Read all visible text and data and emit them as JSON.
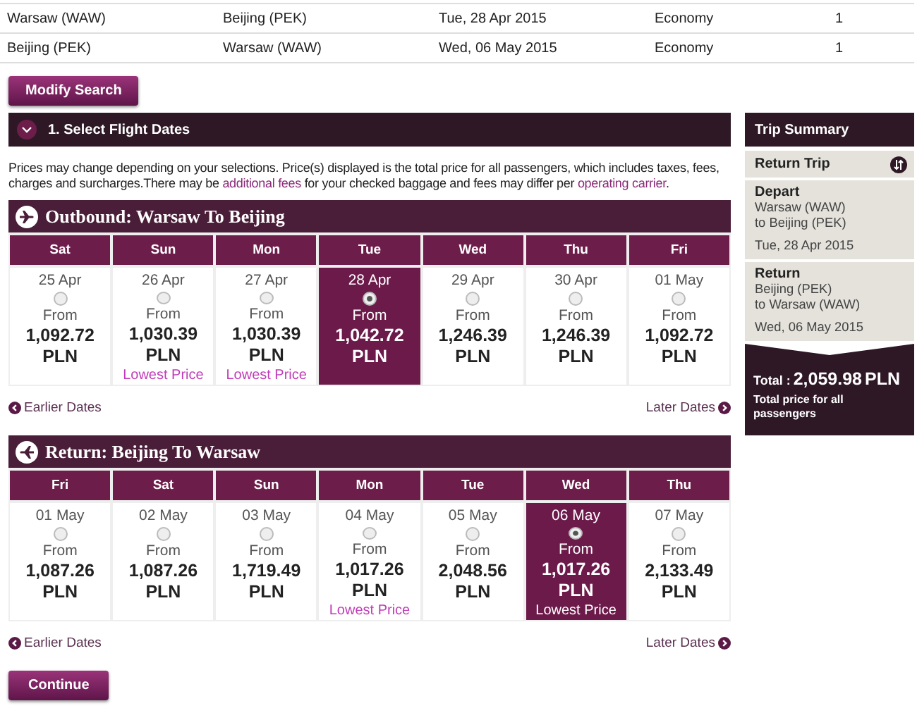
{
  "search_rows": [
    {
      "from": "Warsaw (WAW)",
      "to": "Beijing (PEK)",
      "date": "Tue, 28 Apr 2015",
      "cabin": "Economy",
      "passengers": "1"
    },
    {
      "from": "Beijing (PEK)",
      "to": "Warsaw (WAW)",
      "date": "Wed, 06 May 2015",
      "cabin": "Economy",
      "passengers": "1"
    }
  ],
  "modify_button": "Modify Search",
  "section": {
    "title": "1. Select Flight Dates",
    "expanded": true
  },
  "notice": [
    {
      "kind": "text",
      "text": "Prices may change depending on your selections. Price(s) displayed is the total price for all passengers, which includes taxes, fees, charges and surcharges.There may be "
    },
    {
      "kind": "link",
      "text": "additional fees"
    },
    {
      "kind": "text",
      "text": " for your checked baggage and fees may differ per "
    },
    {
      "kind": "link",
      "text": "operating carrier"
    },
    {
      "kind": "text",
      "text": "."
    }
  ],
  "flights": [
    {
      "kind": "outbound",
      "title": "Outbound: Warsaw To Beijing",
      "earlier": "Earlier Dates",
      "later": "Later Dates",
      "days": [
        {
          "weekday": "Sat",
          "date": "25 Apr",
          "from": "From",
          "price": "1,092.72",
          "currency": "PLN",
          "selected": false
        },
        {
          "weekday": "Sun",
          "date": "26 Apr",
          "from": "From",
          "price": "1,030.39",
          "currency": "PLN",
          "note": "Lowest Price",
          "selected": false
        },
        {
          "weekday": "Mon",
          "date": "27 Apr",
          "from": "From",
          "price": "1,030.39",
          "currency": "PLN",
          "note": "Lowest Price",
          "selected": false
        },
        {
          "weekday": "Tue",
          "date": "28 Apr",
          "from": "From",
          "price": "1,042.72",
          "currency": "PLN",
          "selected": true
        },
        {
          "weekday": "Wed",
          "date": "29 Apr",
          "from": "From",
          "price": "1,246.39",
          "currency": "PLN",
          "selected": false
        },
        {
          "weekday": "Thu",
          "date": "30 Apr",
          "from": "From",
          "price": "1,246.39",
          "currency": "PLN",
          "selected": false
        },
        {
          "weekday": "Fri",
          "date": "01 May",
          "from": "From",
          "price": "1,092.72",
          "currency": "PLN",
          "selected": false
        }
      ]
    },
    {
      "kind": "return",
      "title": "Return: Beijing To Warsaw",
      "earlier": "Earlier Dates",
      "later": "Later Dates",
      "days": [
        {
          "weekday": "Fri",
          "date": "01 May",
          "from": "From",
          "price": "1,087.26",
          "currency": "PLN",
          "selected": false
        },
        {
          "weekday": "Sat",
          "date": "02 May",
          "from": "From",
          "price": "1,087.26",
          "currency": "PLN",
          "selected": false
        },
        {
          "weekday": "Sun",
          "date": "03 May",
          "from": "From",
          "price": "1,719.49",
          "currency": "PLN",
          "selected": false
        },
        {
          "weekday": "Mon",
          "date": "04 May",
          "from": "From",
          "price": "1,017.26",
          "currency": "PLN",
          "note": "Lowest Price",
          "selected": false
        },
        {
          "weekday": "Tue",
          "date": "05 May",
          "from": "From",
          "price": "2,048.56",
          "currency": "PLN",
          "selected": false
        },
        {
          "weekday": "Wed",
          "date": "06 May",
          "from": "From",
          "price": "1,017.26",
          "currency": "PLN",
          "note": "Lowest Price",
          "selected": true
        },
        {
          "weekday": "Thu",
          "date": "07 May",
          "from": "From",
          "price": "2,133.49",
          "currency": "PLN",
          "selected": false
        }
      ]
    }
  ],
  "continue_button": "Continue",
  "summary": {
    "title": "Trip Summary",
    "trip_type": "Return Trip",
    "legs": [
      {
        "label": "Depart",
        "from": "Warsaw (WAW)",
        "to": "to Beijing (PEK)",
        "date": "Tue, 28 Apr 2015"
      },
      {
        "label": "Return",
        "from": "Beijing (PEK)",
        "to": "to Warsaw (WAW)",
        "date": "Wed, 06 May 2015"
      }
    ],
    "total_label": "Total :",
    "total_amount": "2,059.98",
    "total_currency": "PLN",
    "total_note": "Total price for all passengers"
  }
}
